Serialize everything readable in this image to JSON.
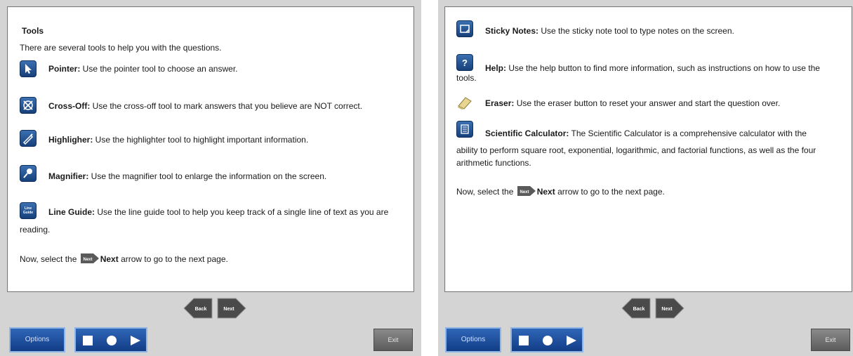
{
  "left_page": {
    "heading": "Tools",
    "intro": "There are several tools to help you with the questions.",
    "tools": [
      {
        "icon": "pointer-icon",
        "name": "Pointer:",
        "desc": " Use the pointer tool to choose an answer."
      },
      {
        "icon": "cross-off-icon",
        "name": "Cross-Off:",
        "desc": " Use the cross-off tool to mark answers that you believe are NOT correct."
      },
      {
        "icon": "highlighter-icon",
        "name": "Highligher:",
        "desc": " Use the highlighter tool to highlight important information."
      },
      {
        "icon": "magnifier-icon",
        "name": "Magnifier:",
        "desc": " Use the magnifier tool to enlarge the information on the screen."
      },
      {
        "icon": "line-guide-icon",
        "name": "Line Guide:",
        "desc": " Use the line guide tool to help you keep track of a single line of text as you are",
        "desc2": "reading.",
        "icon_text": "Line Guide"
      }
    ],
    "next_prefix": "Now, select the",
    "next_bold": "Next",
    "next_suffix": " arrow to go to the next page."
  },
  "right_page": {
    "tools": [
      {
        "icon": "sticky-notes-icon",
        "name": "Sticky Notes:",
        "desc": " Use the sticky note tool to type notes on the screen."
      },
      {
        "icon": "help-icon",
        "name": "Help:",
        "desc": " Use the help button to find more information, such as instructions on how to use the",
        "desc2": "tools.",
        "icon_text": "?"
      },
      {
        "icon": "eraser-icon",
        "name": "Eraser:",
        "desc": " Use the eraser button to reset your answer and start the question over."
      },
      {
        "icon": "calculator-icon",
        "name": "Scientific Calculator:",
        "desc": " The Scientific Calculator is a comprehensive calculator with the",
        "desc2": "ability to perform square root, exponential, logarithmic, and factorial functions, as well as the four",
        "desc3": "arithmetic functions."
      }
    ],
    "next_prefix": "Now, select the",
    "next_bold": "Next",
    "next_suffix": " arrow to go to the next page."
  },
  "nav": {
    "back": "Back",
    "next": "Next"
  },
  "toolbar": {
    "options": "Options",
    "exit": "Exit"
  },
  "icons": {
    "inline_next": "Next"
  }
}
